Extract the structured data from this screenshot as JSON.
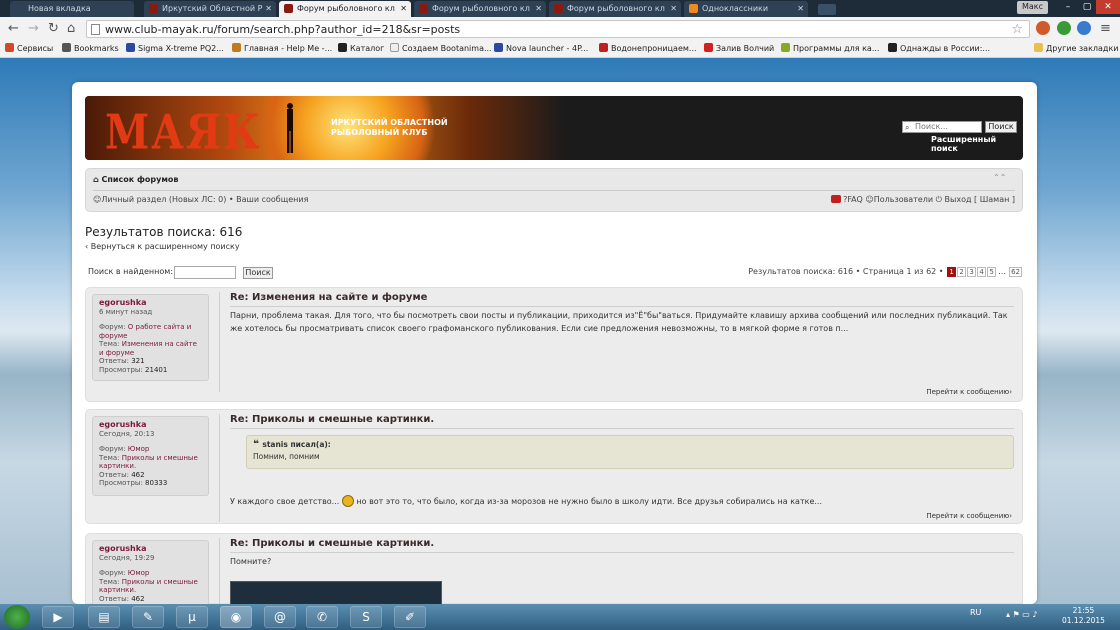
{
  "browser": {
    "tabs": [
      {
        "title": "Новая вкладка",
        "active": false
      },
      {
        "title": "Иркутский Областной Р",
        "active": false
      },
      {
        "title": "Форум рыболовного кл",
        "active": true
      },
      {
        "title": "Форум рыболовного кл",
        "active": false
      },
      {
        "title": "Форум рыболовного кл",
        "active": false
      },
      {
        "title": "Одноклассники",
        "active": false
      }
    ],
    "profile": "Макс",
    "url": "www.club-mayak.ru/forum/search.php?author_id=218&sr=posts",
    "bookmarks": [
      {
        "label": "Сервисы",
        "icon": "apps-icon",
        "color": "#d04a2a"
      },
      {
        "label": "Bookmarks",
        "icon": "star-icon",
        "color": "#555555"
      },
      {
        "label": "Sigma X-treme PQ2...",
        "icon": "sigma-icon",
        "color": "#2a4aa0"
      },
      {
        "label": "Главная - Help Me -...",
        "icon": "helpme-icon",
        "color": "#c07a20"
      },
      {
        "label": "Каталог",
        "icon": "play-icon",
        "color": "#222222"
      },
      {
        "label": "Создаем Bootanima...",
        "icon": "page-icon",
        "color": "#eeeeee"
      },
      {
        "label": "Nova launcher - 4P...",
        "icon": "nova-icon",
        "color": "#2a4aa0"
      },
      {
        "label": "Водонепроницаем...",
        "icon": "shop-icon",
        "color": "#c02020"
      },
      {
        "label": "Залив Волчий",
        "icon": "wolf-icon",
        "color": "#d02020"
      },
      {
        "label": "Программы для ка...",
        "icon": "program-icon",
        "color": "#88aa22"
      },
      {
        "label": "Однажды в России:...",
        "icon": "play-icon",
        "color": "#222222"
      }
    ],
    "other_bookmarks": "Другие закладки"
  },
  "forum": {
    "logo": "МАЯК",
    "club_name_line1": "ИРКУТСКИЙ ОБЛАСТНОЙ",
    "club_name_line2": "РЫБОЛОВНЫЙ КЛУБ",
    "search_placeholder": "Поиск...",
    "search_button": "Поиск",
    "advanced_search": "Расширенный поиск",
    "nav_home": "Список форумов",
    "nav_left": "Личный раздел (Новых ЛС: 0) • Ваши сообщения",
    "nav_faq": "FAQ",
    "nav_users": "Пользователи",
    "nav_logout": "Выход [ Шаман ]",
    "results_title": "Результатов поиска: 616",
    "back_link": "Вернуться к расширенному поиску",
    "search_found_label": "Поиск в найденном:",
    "search_found_button": "Поиск",
    "pagination_text": "Результатов поиска: 616 • Страница 1 из 62 •",
    "pages": [
      "1",
      "2",
      "3",
      "4",
      "5",
      "…",
      "62"
    ],
    "current_page": "1"
  },
  "posts": [
    {
      "author": "egorushka",
      "time": "6 минут назад",
      "forum": "О работе сайта и форуме",
      "topic": "Изменения на сайте и форуме",
      "replies": "321",
      "views": "21401",
      "title": "Re: Изменения на сайте и форуме",
      "text": "Парни, проблема такая. Для того, что бы посмотреть свои посты и публикации, приходится из\"Ё\"бы\"ваться. Придумайте клавишу архива сообщений или последних публикаций. Так же хотелось бы просматривать список своего графоманского публикования. Если сие предложения невозможны, то в мягкой форме я готов п...",
      "goto": "Перейти к сообщению"
    },
    {
      "author": "egorushka",
      "time": "Сегодня, 20:13",
      "forum": "Юмор",
      "topic": "Приколы и смешные картинки.",
      "replies": "462",
      "views": "80333",
      "title": "Re: Приколы и смешные картинки.",
      "quote_author": "stanis писал(а):",
      "quote_text": "Помним, помним",
      "text_before": "У каждого свое детство... ",
      "text_after": " но вот это то, что было, когда из-за морозов не нужно было в школу идти. Все друзья собирались на катке...",
      "goto": "Перейти к сообщению"
    },
    {
      "author": "egorushka",
      "time": "Сегодня, 19:29",
      "forum": "Юмор",
      "topic": "Приколы и смешные картинки.",
      "replies": "462",
      "title": "Re: Приколы и смешные картинки.",
      "text": "Помните?"
    }
  ],
  "labels": {
    "forum": "Форум:",
    "topic": "Тема:",
    "replies": "Ответы:",
    "views": "Просмотры:"
  },
  "taskbar": {
    "lang": "RU",
    "time": "21:55",
    "date": "01.12.2015"
  }
}
